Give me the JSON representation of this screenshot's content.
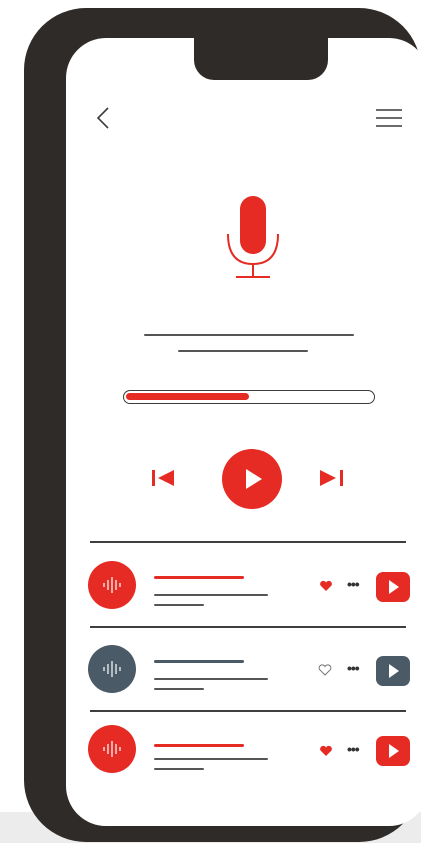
{
  "colors": {
    "accent": "#e52b24",
    "slate": "#4a5a66",
    "frame": "#2f2b29"
  },
  "header": {
    "back_icon": "chevron-left-icon",
    "menu_icon": "hamburger-menu-icon"
  },
  "hero": {
    "icon": "microphone-icon"
  },
  "player": {
    "progress": 0.5,
    "prev_icon": "skip-previous-icon",
    "play_icon": "play-icon",
    "next_icon": "skip-next-icon"
  },
  "tracks": [
    {
      "liked": true,
      "color": "#e52b24"
    },
    {
      "liked": false,
      "color": "#4a5a66"
    },
    {
      "liked": true,
      "color": "#e52b24"
    }
  ]
}
